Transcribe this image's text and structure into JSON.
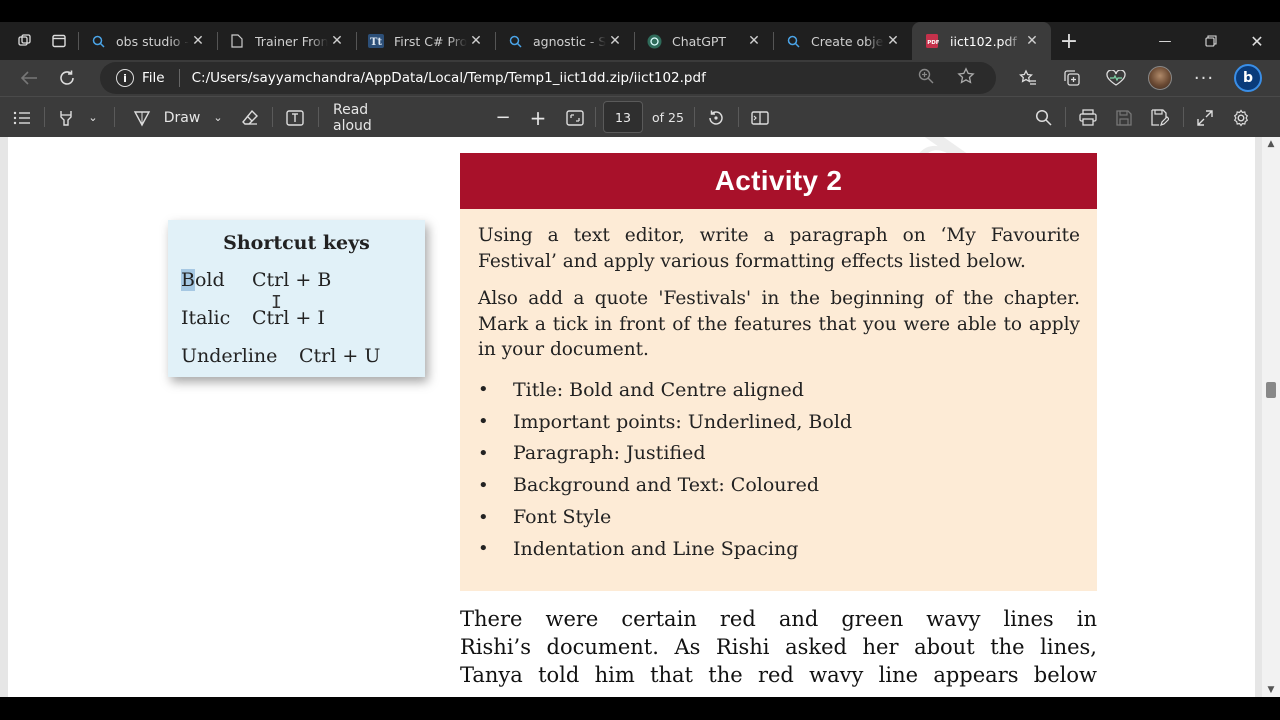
{
  "tabs": [
    {
      "title": "obs studio - Se",
      "icon": "search-icon"
    },
    {
      "title": "Trainer Fronte",
      "icon": "page-icon"
    },
    {
      "title": "First C# Progra",
      "icon": "tt-icon"
    },
    {
      "title": "agnostic - Sea",
      "icon": "search-icon"
    },
    {
      "title": "ChatGPT",
      "icon": "chatgpt-icon"
    },
    {
      "title": "Create object",
      "icon": "search-icon"
    },
    {
      "title": "iict102.pdf",
      "icon": "pdf-icon",
      "active": true
    }
  ],
  "address": {
    "scheme_label": "File",
    "url": "C:/Users/sayyamchandra/AppData/Local/Temp/Temp1_iict1dd.zip/iict102.pdf"
  },
  "pdf_toolbar": {
    "draw_label": "Draw",
    "read_aloud_label": "Read aloud",
    "page_number": "13",
    "page_total": "of 25"
  },
  "shortcut_box": {
    "title": "Shortcut keys",
    "rows": [
      {
        "name_sel": "B",
        "name_rest": "old",
        "keys": "Ctrl + B"
      },
      {
        "name": "Italic",
        "keys": "Ctrl + I"
      },
      {
        "name": "Underline",
        "keys": "Ctrl + U"
      }
    ]
  },
  "activity": {
    "heading": "Activity 2",
    "para1": "Using a text editor, write a paragraph on ‘My Favourite Festival’ and apply various formatting effects listed below.",
    "para2": "Also add a quote 'Festivals' in the beginning of the chapter. Mark a tick in front of the features that you were able to apply in your document.",
    "bullets": [
      "Title: Bold and Centre aligned",
      "Important points: Underlined, Bold",
      "Paragraph: Justified",
      "Background and Text: Coloured",
      "Font Style",
      "Indentation and Line Spacing"
    ]
  },
  "body_lines": [
    "There were certain red and green wavy lines in",
    "Rishi’s document. As Rishi asked her about the lines,",
    "Tanya told him that the red wavy line appears below"
  ],
  "watermark": "ublished"
}
